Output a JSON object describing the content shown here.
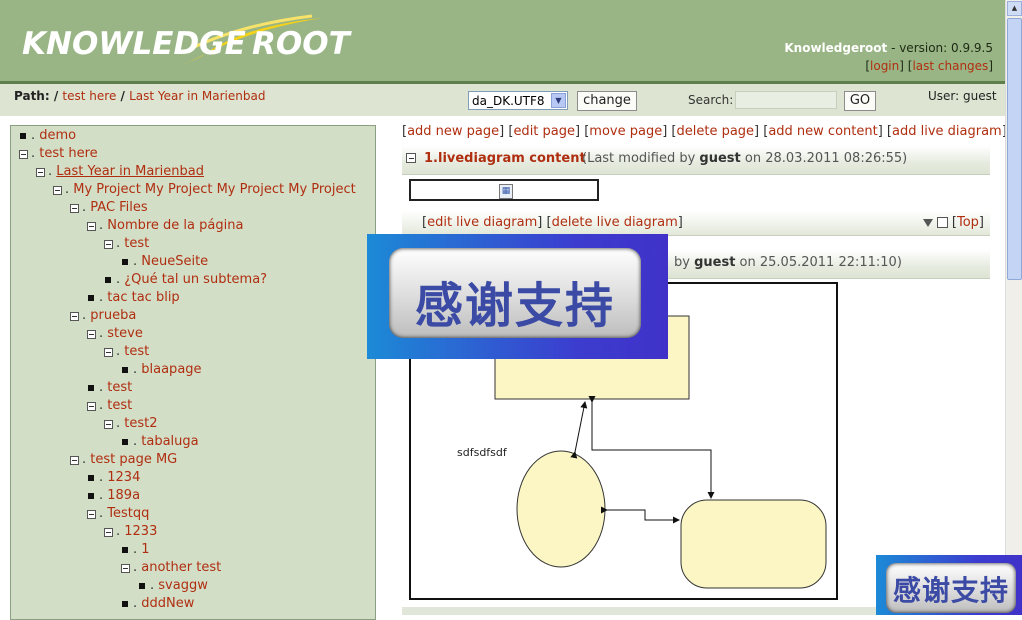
{
  "header": {
    "logo_left": "KNOWLEDGE",
    "logo_right": "ROOT",
    "app_name": "Knowledgeroot",
    "version_text": " - version: 0.9.9.5",
    "login": "login",
    "last_changes": "last changes",
    "colors": {
      "header_bg": "#9ab585",
      "accent": "#b02e10",
      "logo_swoosh": "#f2d21a"
    }
  },
  "pathbar": {
    "label": "Path:",
    "sep": "/",
    "crumbs": [
      "test here",
      "Last Year in Marienbad"
    ],
    "locale": "da_DK.UTF8",
    "change": "change",
    "search_label": "Search:",
    "search_value": "",
    "go": "GO",
    "user": "User: guest"
  },
  "tree": [
    {
      "label": "demo",
      "depth": 0,
      "marker": "square"
    },
    {
      "label": "test here",
      "depth": 0,
      "marker": "minus"
    },
    {
      "label": "Last Year in Marienbad",
      "depth": 1,
      "marker": "minus",
      "current": true
    },
    {
      "label": "My Project My Project My Project My Project",
      "depth": 2,
      "marker": "minus"
    },
    {
      "label": "PAC Files",
      "depth": 3,
      "marker": "minus"
    },
    {
      "label": "Nombre de la página",
      "depth": 4,
      "marker": "minus"
    },
    {
      "label": "test",
      "depth": 5,
      "marker": "minus"
    },
    {
      "label": "NeueSeite",
      "depth": 6,
      "marker": "square"
    },
    {
      "label": "¿Qué tal un subtema?",
      "depth": 5,
      "marker": "square"
    },
    {
      "label": "tac tac blip",
      "depth": 4,
      "marker": "square"
    },
    {
      "label": "prueba",
      "depth": 3,
      "marker": "minus"
    },
    {
      "label": "steve",
      "depth": 4,
      "marker": "minus"
    },
    {
      "label": "test",
      "depth": 5,
      "marker": "minus"
    },
    {
      "label": "blaapage",
      "depth": 6,
      "marker": "square"
    },
    {
      "label": "test",
      "depth": 4,
      "marker": "square"
    },
    {
      "label": "test",
      "depth": 4,
      "marker": "minus"
    },
    {
      "label": "test2",
      "depth": 5,
      "marker": "minus"
    },
    {
      "label": "tabaluga",
      "depth": 6,
      "marker": "square"
    },
    {
      "label": "test page MG",
      "depth": 3,
      "marker": "minus"
    },
    {
      "label": "1234",
      "depth": 4,
      "marker": "square"
    },
    {
      "label": "189a",
      "depth": 4,
      "marker": "square"
    },
    {
      "label": "Testqq",
      "depth": 4,
      "marker": "minus"
    },
    {
      "label": "1233",
      "depth": 5,
      "marker": "minus"
    },
    {
      "label": "1",
      "depth": 6,
      "marker": "square"
    },
    {
      "label": "another test",
      "depth": 6,
      "marker": "minus"
    },
    {
      "label": "svaggw",
      "depth": 7,
      "marker": "square"
    },
    {
      "label": "dddNew",
      "depth": 6,
      "marker": "square"
    }
  ],
  "actions": [
    "add new page",
    "edit page",
    "move page",
    "delete page",
    "add new content",
    "add live diagram"
  ],
  "content1": {
    "title": "1.livediagram content",
    "meta_prefix": "(Last modified by ",
    "meta_user": "guest",
    "meta_date": " on 28.03.2011 08:26:55)"
  },
  "content1_footer": {
    "links": [
      "edit live diagram",
      "delete live diagram"
    ],
    "top": "Top"
  },
  "content2": {
    "meta_prefix": "by ",
    "meta_user": "guest",
    "meta_date": " on 25.05.2011 22:11:10)"
  },
  "diagram": {
    "label": "sdfsdfsdf"
  },
  "overlay": {
    "text": "感谢支持"
  }
}
